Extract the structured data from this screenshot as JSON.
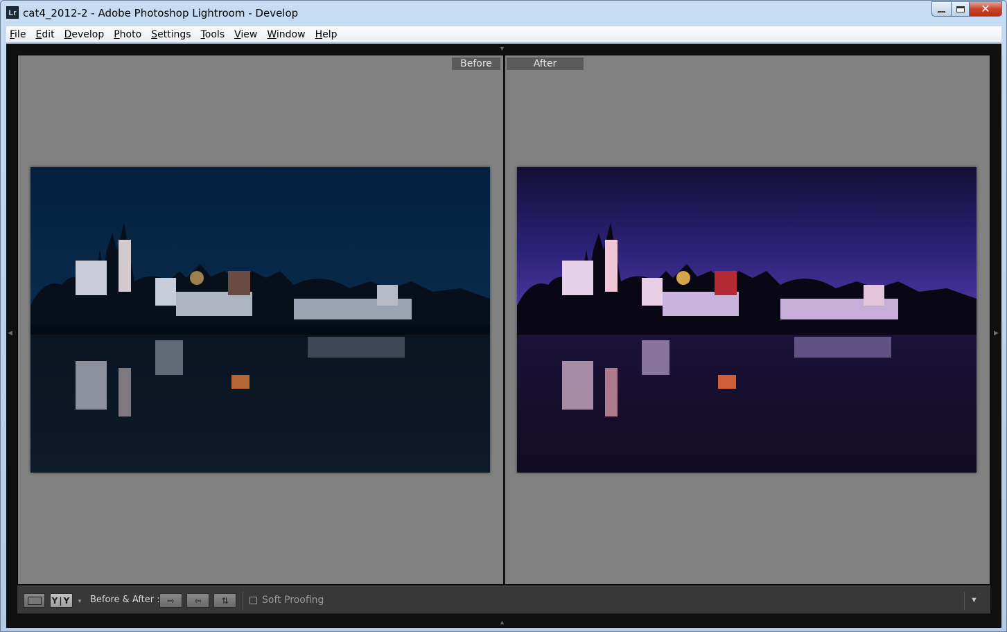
{
  "window": {
    "app_icon": "Lr",
    "title": "cat4_2012-2 - Adobe Photoshop Lightroom - Develop",
    "controls": {
      "minimize": "minimize-icon",
      "maximize": "maximize-icon",
      "close": "✕"
    }
  },
  "menu": [
    {
      "u": "F",
      "rest": "ile"
    },
    {
      "u": "E",
      "rest": "dit"
    },
    {
      "u": "D",
      "rest": "evelop"
    },
    {
      "u": "P",
      "rest": "hoto"
    },
    {
      "u": "S",
      "rest": "ettings"
    },
    {
      "u": "T",
      "rest": "ools"
    },
    {
      "u": "V",
      "rest": "iew"
    },
    {
      "u": "W",
      "rest": "indow"
    },
    {
      "u": "H",
      "rest": "elp"
    }
  ],
  "viewer": {
    "before_label": "Before",
    "after_label": "After"
  },
  "toolbar": {
    "yy_label": "Y|Y",
    "before_after_label": "Before & After :",
    "soft_proofing_label": "Soft Proofing",
    "soft_proofing_checked": false
  },
  "colors": {
    "before_sky_top": "#05203f",
    "before_water": "#0c1523",
    "after_sky_top": "#1a1446",
    "after_sky_glow": "#5a3fae",
    "after_water": "#120c22"
  }
}
